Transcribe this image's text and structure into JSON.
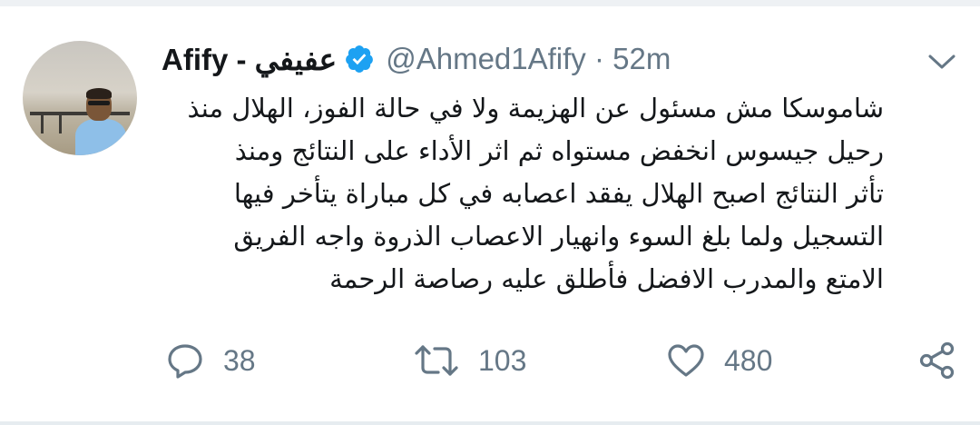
{
  "tweet": {
    "display_name": "Afify - عفيفي",
    "handle_time": "@Ahmed1Afify · 52m",
    "text_lines": [
      "شاموسكا مش مسئول عن الهزيمة ولا في حالة الفوز، الهلال منذ",
      "رحيل جيسوس انخفض مستواه ثم اثر الأداء على النتائج ومنذ",
      "تأثر النتائج اصبح الهلال يفقد اعصابه في كل مباراة يتأخر فيها",
      "التسجيل ولما بلغ السوء وانهيار الاعصاب الذروة واجه الفريق",
      "الامتع والمدرب الافضل فأطلق عليه رصاصة الرحمة"
    ]
  },
  "actions": {
    "reply_count": "38",
    "retweet_count": "103",
    "like_count": "480"
  },
  "icons": {
    "verified": "verified-badge-icon",
    "menu": "chevron-down-icon",
    "reply": "reply-icon",
    "retweet": "retweet-icon",
    "like": "heart-icon",
    "share": "share-icon"
  },
  "colors": {
    "verified_blue": "#1da1f2",
    "secondary_text": "#657786",
    "primary_text": "#14171a"
  }
}
